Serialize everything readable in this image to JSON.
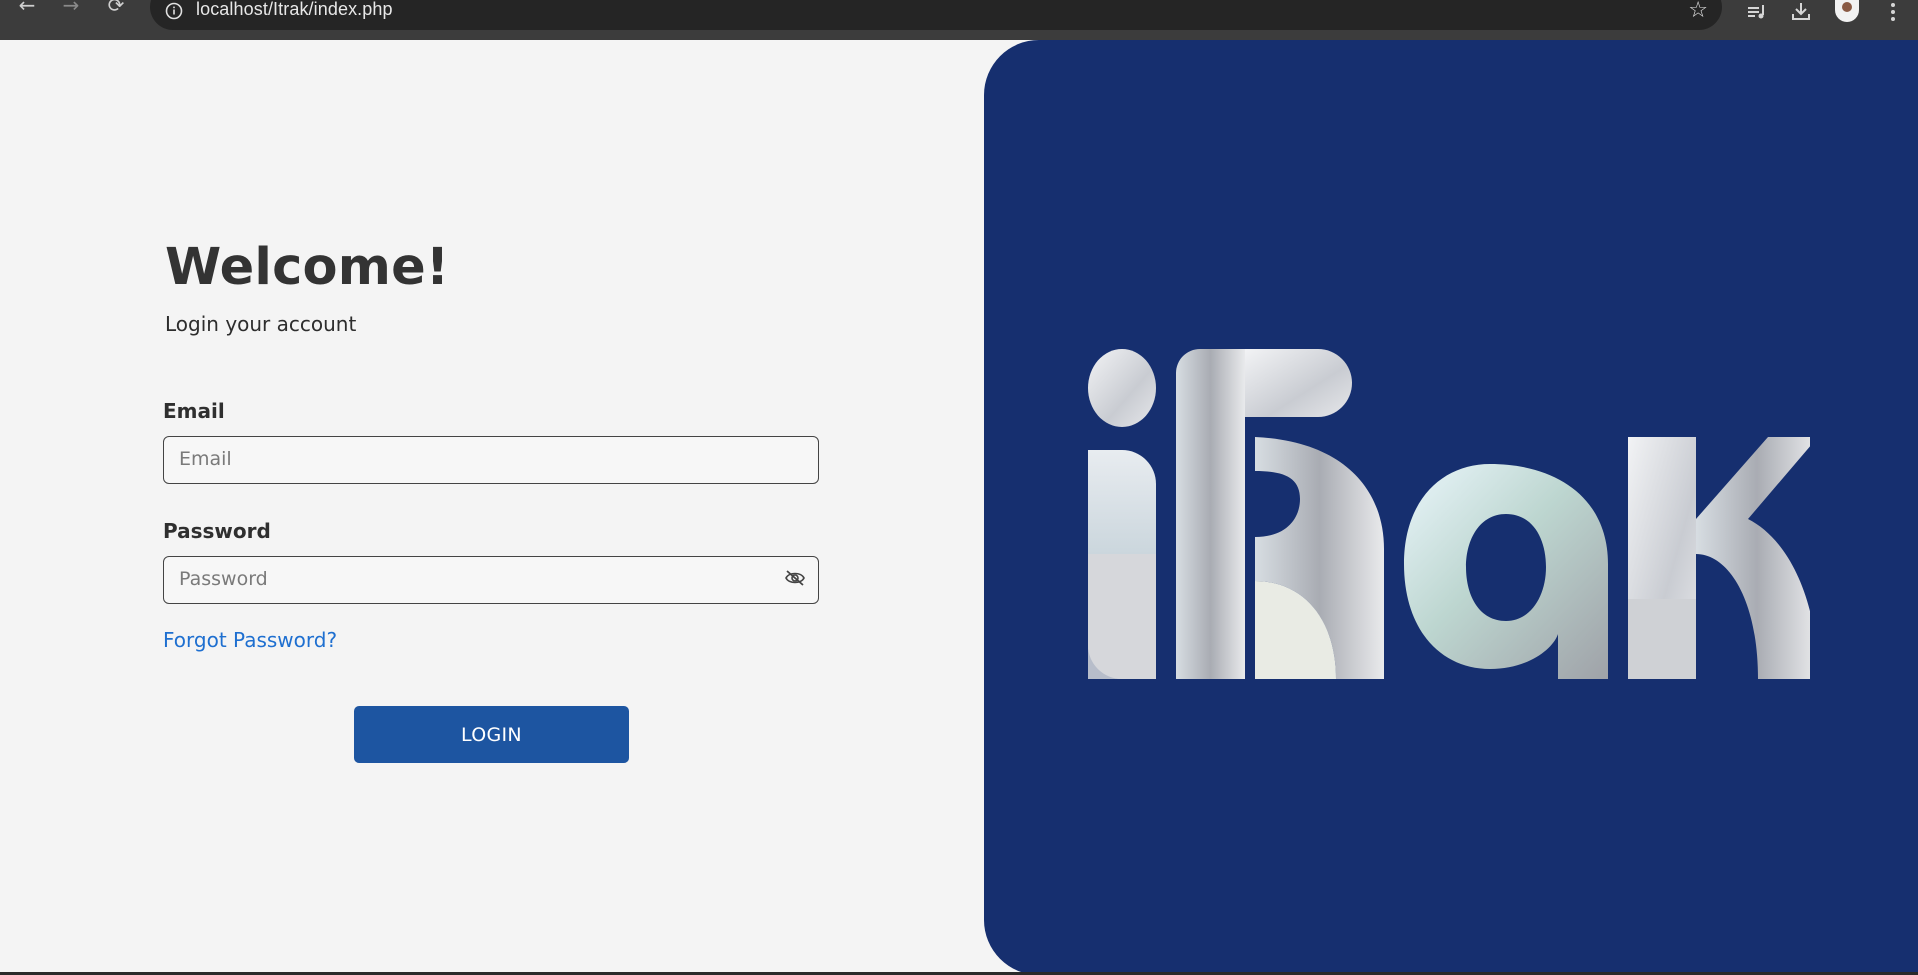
{
  "browser": {
    "url": "localhost/Itrak/index.php",
    "back_icon": "arrow-left-icon",
    "forward_icon": "arrow-right-icon",
    "reload_icon": "reload-icon"
  },
  "login": {
    "title": "Welcome!",
    "subtitle": "Login your account",
    "email_label": "Email",
    "email_placeholder": "Email",
    "email_value": "",
    "password_label": "Password",
    "password_placeholder": "Password",
    "password_value": "",
    "forgot_link": "Forgot Password?",
    "login_button": "LOGIN"
  },
  "brand": {
    "logo_text": "iTrak",
    "panel_color": "#162f6f"
  },
  "colors": {
    "accent": "#1d55a1",
    "link": "#1e6fd0",
    "text": "#333333"
  }
}
